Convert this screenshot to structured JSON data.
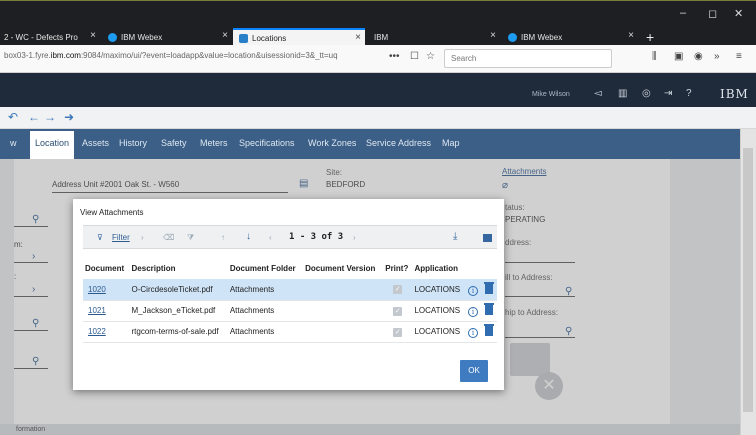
{
  "browser": {
    "tabs": [
      {
        "label": "2 - WC - Defects Pro"
      },
      {
        "label": "IBM Webex"
      },
      {
        "label": "Locations"
      },
      {
        "label": "IBM"
      },
      {
        "label": "IBM Webex"
      }
    ],
    "url_prefix": "box03-1.fyre.",
    "url_domain": "ibm.com",
    "url_suffix": ":9084/maximo/ui/?event=loadapp&value=location&uisessionid=3&_tt=uq",
    "search_placeholder": "Search",
    "menu_dots": "•••"
  },
  "header": {
    "user": "Mike Wilson",
    "logo": "IBM"
  },
  "app_tabs": [
    {
      "label": "w"
    },
    {
      "label": "Location"
    },
    {
      "label": "Assets"
    },
    {
      "label": "History"
    },
    {
      "label": "Safety"
    },
    {
      "label": "Meters"
    },
    {
      "label": "Specifications"
    },
    {
      "label": "Work Zones"
    },
    {
      "label": "Service Address"
    },
    {
      "label": "Map"
    }
  ],
  "form": {
    "address": "Address Unit #2001 Oak St. - W560",
    "site_label": "Site:",
    "site_value": "BEDFORD",
    "attachments_link": "Attachments",
    "status_label": "tatus:",
    "status_value": "PERATING",
    "address_label": "ddress:",
    "bill_to_label": "ill to Address:",
    "ship_to_label": "hip to Address:",
    "left_label_1": "m:",
    "left_label_2": ":",
    "bottom_section": "formation"
  },
  "dialog": {
    "title": "View Attachments",
    "filter_label": "Filter",
    "pager": "1 - 3 of 3",
    "columns": [
      "Document",
      "Description",
      "Document Folder",
      "Document Version",
      "Print?",
      "Application"
    ],
    "rows": [
      {
        "document": "1020",
        "description": "O-CircdesoleTicket.pdf",
        "folder": "Attachments",
        "version": "",
        "application": "LOCATIONS"
      },
      {
        "document": "1021",
        "description": "M_Jackson_eTicket.pdf",
        "folder": "Attachments",
        "version": "",
        "application": "LOCATIONS"
      },
      {
        "document": "1022",
        "description": "rtgcom-terms-of-sale.pdf",
        "folder": "Attachments",
        "version": "",
        "application": "LOCATIONS"
      }
    ],
    "ok_label": "OK"
  }
}
